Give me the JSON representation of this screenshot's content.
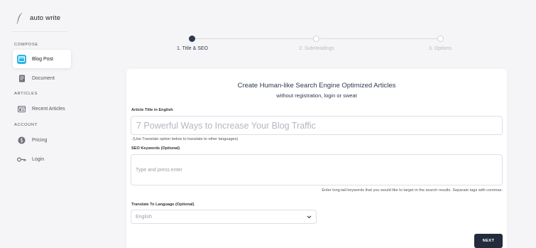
{
  "brand": {
    "name": "auto write"
  },
  "sidebar": {
    "sections": [
      {
        "label": "COMPOSE"
      },
      {
        "label": "ARTICLES"
      },
      {
        "label": "ACCOUNT"
      }
    ],
    "items": [
      {
        "label": "Blog Post",
        "icon": "browser-window-icon",
        "active": true
      },
      {
        "label": "Document",
        "icon": "document-icon",
        "active": false
      },
      {
        "label": "Recent Articles",
        "icon": "article-list-icon",
        "active": false
      },
      {
        "label": "Pricing",
        "icon": "dollar-icon",
        "active": false
      },
      {
        "label": "Login",
        "icon": "key-icon",
        "active": false
      }
    ]
  },
  "stepper": {
    "steps": [
      {
        "label": "1. Title & SEO",
        "active": true
      },
      {
        "label": "2. SubHeadings",
        "active": false
      },
      {
        "label": "3. Options",
        "active": false
      }
    ]
  },
  "form": {
    "title": "Create Human-like Search Engine Optimized Articles",
    "subtitle": "without registration, login or sweat",
    "article_title_label": "Article Title in English",
    "article_title_placeholder": "7 Powerful Ways to Increase Your Blog Traffic",
    "translate_hint": "(Use Translate option below to translate to other languages)",
    "seo_label": "SEO Keywords (Optional)",
    "seo_placeholder": "Type and press enter",
    "seo_hint": "Enter long-tail keywords that you would like to target in the search results. Separate tags with commas.",
    "language_label": "Translate To Language (Optional)",
    "language_value": "English",
    "next_label": "NEXT"
  },
  "colors": {
    "accent": "#2bb4e6",
    "dark": "#222c3c",
    "step_active": "#2d3a4e"
  }
}
